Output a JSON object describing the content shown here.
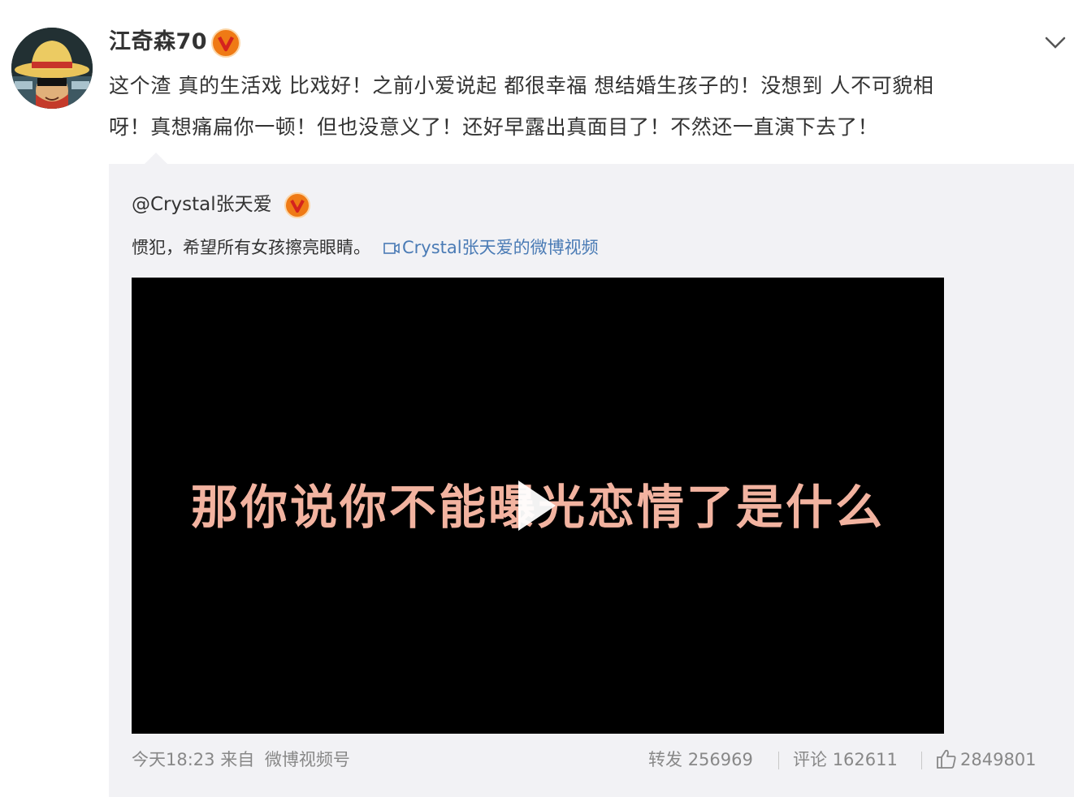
{
  "post": {
    "author_name": "江奇森70",
    "author_verified_icon": "verified-v-badge",
    "text_line1": "这个渣 真的生活戏 比戏好！之前小爱说起 都很幸福 想结婚生孩子的！没想到 人不可貌相",
    "text_line2": "呀！真想痛扁你一顿！但也没意义了！还好早露出真面目了！不然还一直演下去了！"
  },
  "repost": {
    "author": "@Crystal张天爱",
    "text": "惯犯，希望所有女孩擦亮眼睛。",
    "video_link": "Crystal张天爱的微博视频",
    "video": {
      "caption": "那你说你不能曝光恋情了是什么"
    },
    "time": "今天18:23",
    "from_label": "来自",
    "source": "微博视频号",
    "repost_label": "转发",
    "repost_count": "256969",
    "comment_label": "评论",
    "comment_count": "162611",
    "like_count": "2849801"
  },
  "colors": {
    "badge_orange": "#ef7a15",
    "link_blue": "#4a7bb5",
    "repost_bg": "#f2f2f5",
    "caption": "#f2b3a0"
  }
}
